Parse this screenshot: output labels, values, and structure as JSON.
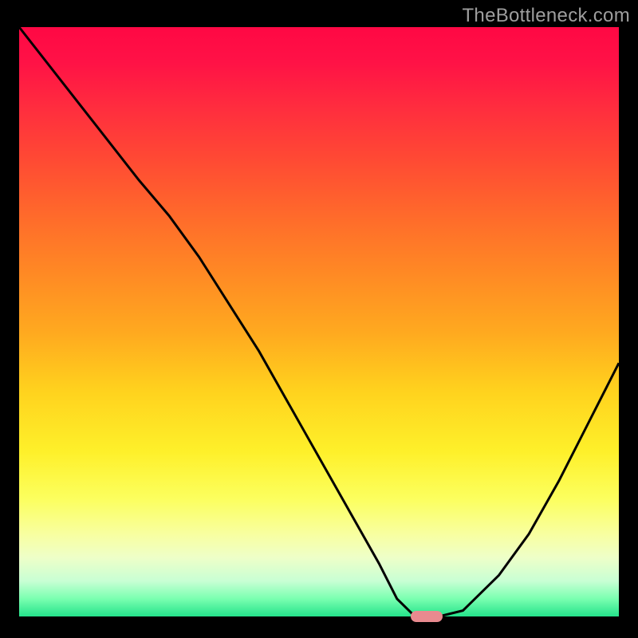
{
  "watermark": "TheBottleneck.com",
  "chart_data": {
    "type": "line",
    "title": "",
    "xlabel": "",
    "ylabel": "",
    "x": [
      0.0,
      0.1,
      0.2,
      0.25,
      0.3,
      0.35,
      0.4,
      0.45,
      0.5,
      0.55,
      0.6,
      0.63,
      0.66,
      0.7,
      0.74,
      0.8,
      0.85,
      0.9,
      0.95,
      1.0
    ],
    "values": [
      1.0,
      0.87,
      0.74,
      0.68,
      0.61,
      0.53,
      0.45,
      0.36,
      0.27,
      0.18,
      0.09,
      0.03,
      0.0,
      0.0,
      0.01,
      0.07,
      0.14,
      0.23,
      0.33,
      0.43
    ],
    "xlim": [
      0,
      1
    ],
    "ylim": [
      0,
      1
    ],
    "optimal_x": 0.68,
    "optimal_y": 0.0,
    "gradient_stops": [
      {
        "pos": 0.0,
        "color": "#ff0844"
      },
      {
        "pos": 0.5,
        "color": "#ffaa1f"
      },
      {
        "pos": 0.8,
        "color": "#fcff5e"
      },
      {
        "pos": 1.0,
        "color": "#24e38b"
      }
    ]
  }
}
